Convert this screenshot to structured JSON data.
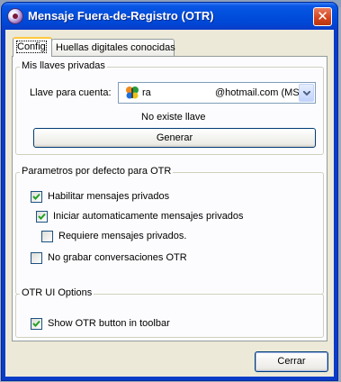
{
  "window": {
    "title": "Mensaje Fuera-de-Registro (OTR)",
    "close_glyph": "✕"
  },
  "tabs": [
    {
      "label": "Config",
      "active": true
    },
    {
      "label": "Huellas digitales conocidas",
      "active": false
    }
  ],
  "private_keys": {
    "legend": "Mis llaves privadas",
    "account_label": "Llave para cuenta:",
    "account_name": "ra",
    "account_suffix": "@hotmail.com (MSN)",
    "account_icon": "msn-butterfly-icon",
    "no_key_text": "No existe llave",
    "generate_button": "Generar"
  },
  "defaults": {
    "legend": "Parametros por defecto para OTR",
    "enable_private": {
      "label": "Habilitar mensajes privados",
      "checked": true
    },
    "auto_start": {
      "label": "Iniciar automaticamente mensajes privados",
      "checked": true
    },
    "require_private": {
      "label": "Requiere mensajes privados.",
      "checked": false
    },
    "no_logging": {
      "label": "No grabar conversaciones OTR",
      "checked": false
    }
  },
  "ui_options": {
    "legend": "OTR UI Options",
    "show_button": {
      "label": "Show OTR button in toolbar",
      "checked": true
    }
  },
  "close_button": "Cerrar",
  "colors": {
    "title_bar": "#0a55e5",
    "client_bg": "#ece9d8",
    "panel_bg": "#fcfcfe",
    "check_green": "#21a121",
    "focus_tab": "#ffc83c"
  }
}
